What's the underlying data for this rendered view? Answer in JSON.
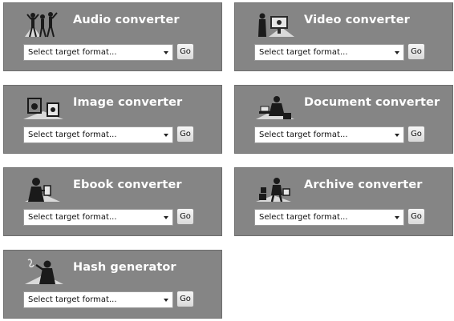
{
  "converters": [
    {
      "title": "Audio converter",
      "icon": "audio-people-icon",
      "placeholder": "Select target format...",
      "button": "Go"
    },
    {
      "title": "Video converter",
      "icon": "video-viewer-icon",
      "placeholder": "Select target format...",
      "button": "Go"
    },
    {
      "title": "Image converter",
      "icon": "image-frames-icon",
      "placeholder": "Select target format...",
      "button": "Go"
    },
    {
      "title": "Document converter",
      "icon": "document-reader-icon",
      "placeholder": "Select target format...",
      "button": "Go"
    },
    {
      "title": "Ebook converter",
      "icon": "ebook-reader-icon",
      "placeholder": "Select target format...",
      "button": "Go"
    },
    {
      "title": "Archive converter",
      "icon": "archive-boxes-icon",
      "placeholder": "Select target format...",
      "button": "Go"
    },
    {
      "title": "Hash generator",
      "icon": "hash-person-icon",
      "placeholder": "Select target format...",
      "button": "Go"
    }
  ],
  "colors": {
    "card_bg": "#858585",
    "title": "#ffffff"
  }
}
